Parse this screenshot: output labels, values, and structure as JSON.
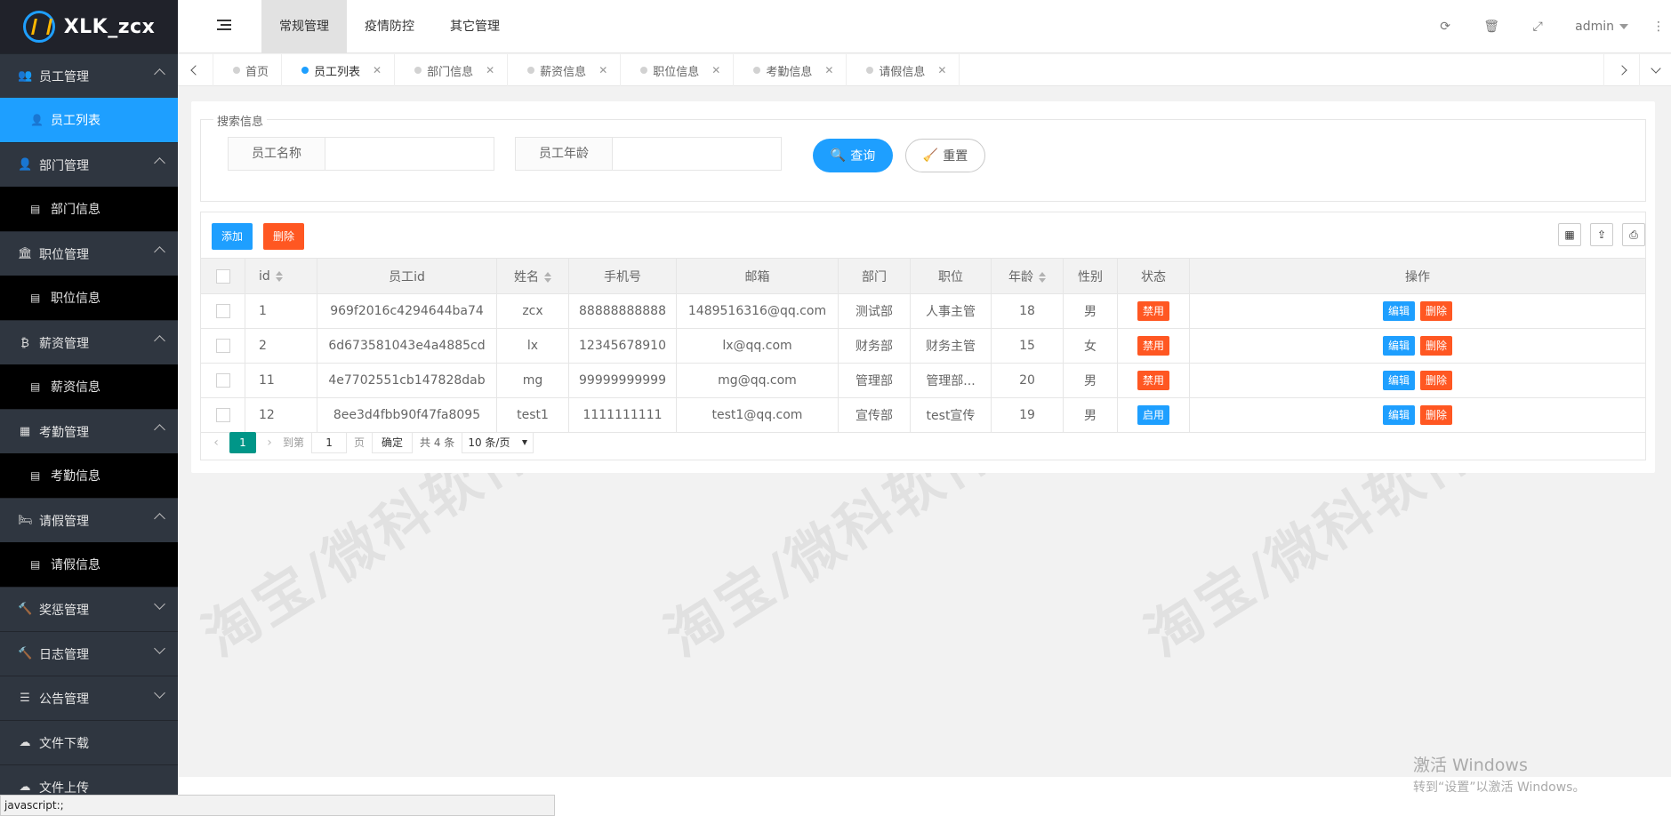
{
  "app": {
    "title": "XLK_zcx"
  },
  "sidebar": {
    "groups": [
      {
        "label": "员工管理",
        "icon": "users-icon",
        "expanded": true,
        "children": [
          {
            "label": "员工列表",
            "active": true
          }
        ]
      },
      {
        "label": "部门管理",
        "icon": "user-icon",
        "expanded": true,
        "children": [
          {
            "label": "部门信息",
            "active": false
          }
        ]
      },
      {
        "label": "职位管理",
        "icon": "bank-icon",
        "expanded": true,
        "children": [
          {
            "label": "职位信息",
            "active": false
          }
        ]
      },
      {
        "label": "薪资管理",
        "icon": "bitcoin-icon",
        "expanded": true,
        "children": [
          {
            "label": "薪资信息",
            "active": false
          }
        ]
      },
      {
        "label": "考勤管理",
        "icon": "calendar-icon",
        "expanded": true,
        "children": [
          {
            "label": "考勤信息",
            "active": false
          }
        ]
      },
      {
        "label": "请假管理",
        "icon": "bed-icon",
        "expanded": true,
        "children": [
          {
            "label": "请假信息",
            "active": false
          }
        ]
      },
      {
        "label": "奖惩管理",
        "icon": "gavel-icon",
        "expanded": false
      },
      {
        "label": "日志管理",
        "icon": "gavel-icon",
        "expanded": false
      },
      {
        "label": "公告管理",
        "icon": "list-icon",
        "expanded": false
      },
      {
        "label": "文件下载",
        "icon": "cloud-download-icon",
        "expanded": null
      },
      {
        "label": "文件上传",
        "icon": "cloud-upload-icon",
        "expanded": null
      }
    ]
  },
  "header": {
    "nav": [
      "常规管理",
      "疫情防控",
      "其它管理"
    ],
    "active_nav": 0,
    "user": "admin"
  },
  "tabs": [
    {
      "label": "首页",
      "closable": false,
      "active": false
    },
    {
      "label": "员工列表",
      "closable": true,
      "active": true
    },
    {
      "label": "部门信息",
      "closable": true,
      "active": false
    },
    {
      "label": "薪资信息",
      "closable": true,
      "active": false
    },
    {
      "label": "职位信息",
      "closable": true,
      "active": false
    },
    {
      "label": "考勤信息",
      "closable": true,
      "active": false
    },
    {
      "label": "请假信息",
      "closable": true,
      "active": false
    }
  ],
  "search": {
    "legend": "搜索信息",
    "name_label": "员工名称",
    "name_value": "",
    "age_label": "员工年龄",
    "age_value": "",
    "query_label": "查询",
    "reset_label": "重置"
  },
  "toolbar": {
    "add_label": "添加",
    "delete_label": "删除"
  },
  "table": {
    "columns": [
      "id",
      "员工id",
      "姓名",
      "手机号",
      "邮箱",
      "部门",
      "职位",
      "年龄",
      "性别",
      "状态",
      "操作"
    ],
    "rows": [
      {
        "id": "1",
        "uid": "969f2016c4294644ba74",
        "name": "zcx",
        "phone": "88888888888",
        "email": "1489516316@qq.com",
        "dept": "测试部",
        "position": "人事主管",
        "age": "18",
        "gender": "男",
        "status": "禁用"
      },
      {
        "id": "2",
        "uid": "6d673581043e4a4885cd",
        "name": "lx",
        "phone": "12345678910",
        "email": "lx@qq.com",
        "dept": "财务部",
        "position": "财务主管",
        "age": "15",
        "gender": "女",
        "status": "禁用"
      },
      {
        "id": "11",
        "uid": "4e7702551cb147828dab",
        "name": "mg",
        "phone": "99999999999",
        "email": "mg@qq.com",
        "dept": "管理部",
        "position": "管理部...",
        "age": "20",
        "gender": "男",
        "status": "禁用"
      },
      {
        "id": "12",
        "uid": "8ee3d4fbb90f47fa8095",
        "name": "test1",
        "phone": "1111111111",
        "email": "test1@qq.com",
        "dept": "宣传部",
        "position": "test宣传",
        "age": "19",
        "gender": "男",
        "status": "启用"
      }
    ],
    "edit_label": "编辑",
    "delete_label": "删除"
  },
  "pager": {
    "current": "1",
    "goto_prefix": "到第",
    "goto_value": "1",
    "goto_suffix": "页",
    "confirm": "确定",
    "total": "共 4 条",
    "limit": "10 条/页"
  },
  "watermark": "淘宝/微科软件",
  "windows": {
    "line1": "激活 Windows",
    "line2": "转到“设置”以激活 Windows。"
  },
  "statusbar": "javascript:;",
  "colors": {
    "primary": "#1e9fff",
    "danger": "#ff5722",
    "pager": "#009688",
    "sidebar": "#20222a"
  }
}
